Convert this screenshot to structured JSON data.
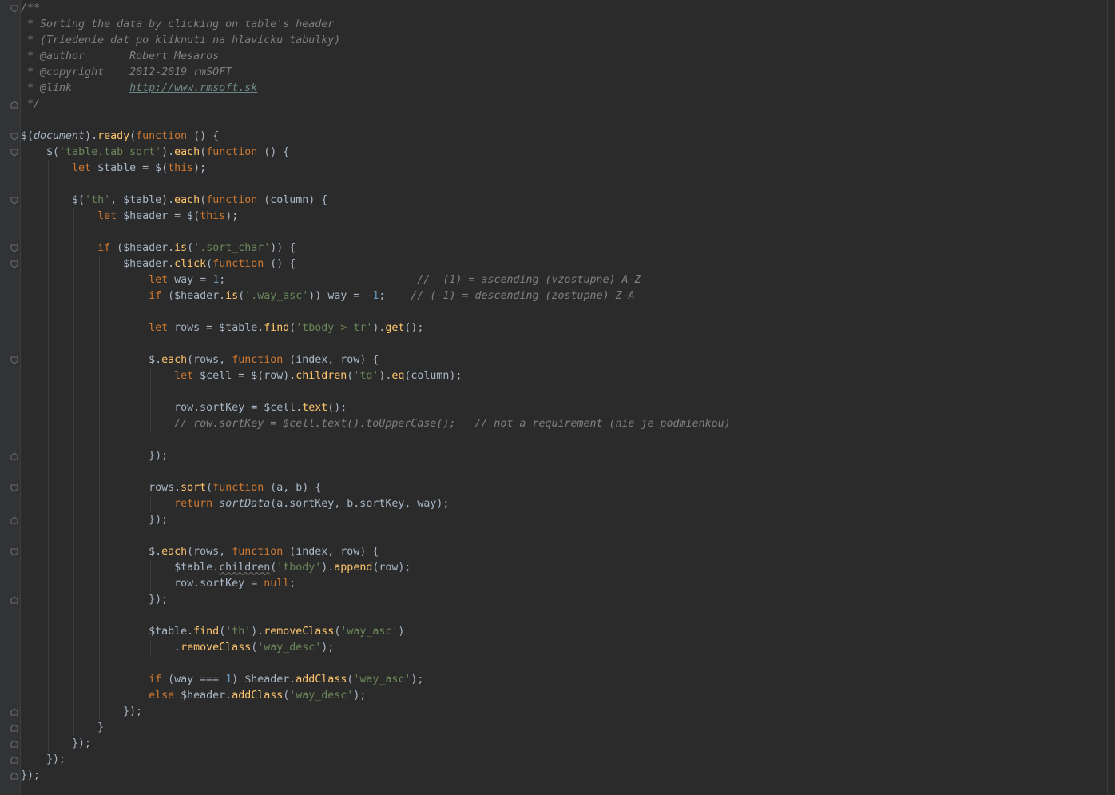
{
  "editor": {
    "language": "javascript",
    "colors": {
      "background": "#2b2b2b",
      "gutter": "#313335",
      "keyword": "#cc7832",
      "string": "#6a8759",
      "number": "#6897bb",
      "function": "#ffc66d",
      "comment": "#808080",
      "text": "#a9b7c6"
    },
    "lines": [
      [
        [
          "cmt",
          "/**"
        ]
      ],
      [
        [
          "cmt",
          " * Sorting the data by clicking on table's header"
        ]
      ],
      [
        [
          "cmt",
          " * (Triedenie dat po kliknuti na hlavicku tabulky)"
        ]
      ],
      [
        [
          "cmt",
          " * "
        ],
        [
          "tag",
          "@author"
        ],
        [
          "cmt",
          "       Robert Mesaros"
        ]
      ],
      [
        [
          "cmt",
          " * "
        ],
        [
          "tag",
          "@copyright"
        ],
        [
          "cmt",
          "    2012-2019 rmSOFT"
        ]
      ],
      [
        [
          "cmt",
          " * "
        ],
        [
          "tag",
          "@link"
        ],
        [
          "cmt",
          "         "
        ],
        [
          "url",
          "http://www.rmsoft.sk"
        ]
      ],
      [
        [
          "cmt",
          " */"
        ]
      ],
      [],
      [
        [
          "plain",
          "$("
        ],
        [
          "glob",
          "document"
        ],
        [
          "plain",
          ")."
        ],
        [
          "fn",
          "ready"
        ],
        [
          "plain",
          "("
        ],
        [
          "kw",
          "function"
        ],
        [
          "plain",
          " () {"
        ]
      ],
      [
        [
          "plain",
          "    $("
        ],
        [
          "str",
          "'table.tab_sort'"
        ],
        [
          "plain",
          ")."
        ],
        [
          "fn",
          "each"
        ],
        [
          "plain",
          "("
        ],
        [
          "kw",
          "function"
        ],
        [
          "plain",
          " () {"
        ]
      ],
      [
        [
          "plain",
          "        "
        ],
        [
          "kw",
          "let "
        ],
        [
          "plain",
          "$table = $("
        ],
        [
          "kw",
          "this"
        ],
        [
          "plain",
          ");"
        ]
      ],
      [],
      [
        [
          "plain",
          "        $("
        ],
        [
          "str",
          "'th'"
        ],
        [
          "plain",
          ", $table)."
        ],
        [
          "fn",
          "each"
        ],
        [
          "plain",
          "("
        ],
        [
          "kw",
          "function"
        ],
        [
          "plain",
          " (column) {"
        ]
      ],
      [
        [
          "plain",
          "            "
        ],
        [
          "kw",
          "let "
        ],
        [
          "plain",
          "$header = $("
        ],
        [
          "kw",
          "this"
        ],
        [
          "plain",
          ");"
        ]
      ],
      [],
      [
        [
          "plain",
          "            "
        ],
        [
          "kw",
          "if "
        ],
        [
          "plain",
          "($header."
        ],
        [
          "fn",
          "is"
        ],
        [
          "plain",
          "("
        ],
        [
          "str",
          "'.sort_char'"
        ],
        [
          "plain",
          ")) {"
        ]
      ],
      [
        [
          "plain",
          "                $header."
        ],
        [
          "fn",
          "click"
        ],
        [
          "plain",
          "("
        ],
        [
          "kw",
          "function"
        ],
        [
          "plain",
          " () {"
        ]
      ],
      [
        [
          "plain",
          "                    "
        ],
        [
          "kw",
          "let "
        ],
        [
          "plain",
          "way = "
        ],
        [
          "num",
          "1"
        ],
        [
          "plain",
          ";                              "
        ],
        [
          "cmt",
          "//  (1) = ascending (vzostupne) A-Z"
        ]
      ],
      [
        [
          "plain",
          "                    "
        ],
        [
          "kw",
          "if "
        ],
        [
          "plain",
          "($header."
        ],
        [
          "fn",
          "is"
        ],
        [
          "plain",
          "("
        ],
        [
          "str",
          "'.way_asc'"
        ],
        [
          "plain",
          ")) way = -"
        ],
        [
          "num",
          "1"
        ],
        [
          "plain",
          ";    "
        ],
        [
          "cmt",
          "// (-1) = descending (zostupne) Z-A"
        ]
      ],
      [],
      [
        [
          "plain",
          "                    "
        ],
        [
          "kw",
          "let "
        ],
        [
          "plain",
          "rows = $table."
        ],
        [
          "fn",
          "find"
        ],
        [
          "plain",
          "("
        ],
        [
          "str",
          "'tbody > tr'"
        ],
        [
          "plain",
          ")."
        ],
        [
          "fn",
          "get"
        ],
        [
          "plain",
          "();"
        ]
      ],
      [],
      [
        [
          "plain",
          "                    $."
        ],
        [
          "fn",
          "each"
        ],
        [
          "plain",
          "(rows, "
        ],
        [
          "kw",
          "function"
        ],
        [
          "plain",
          " (index, row) {"
        ]
      ],
      [
        [
          "plain",
          "                        "
        ],
        [
          "kw",
          "let "
        ],
        [
          "plain",
          "$cell = $(row)."
        ],
        [
          "fn",
          "children"
        ],
        [
          "plain",
          "("
        ],
        [
          "str",
          "'td'"
        ],
        [
          "plain",
          ")."
        ],
        [
          "fn",
          "eq"
        ],
        [
          "plain",
          "(column);"
        ]
      ],
      [],
      [
        [
          "plain",
          "                        row."
        ],
        [
          "plain",
          "sortKey"
        ],
        [
          "plain",
          " = $cell."
        ],
        [
          "fn",
          "text"
        ],
        [
          "plain",
          "();"
        ]
      ],
      [
        [
          "plain",
          "                        "
        ],
        [
          "cmt",
          "// row.sortKey = $cell.text().toUpperCase();   // not a requirement (nie je podmienkou)"
        ]
      ],
      [],
      [
        [
          "plain",
          "                    });"
        ]
      ],
      [],
      [
        [
          "plain",
          "                    rows."
        ],
        [
          "fn",
          "sort"
        ],
        [
          "plain",
          "("
        ],
        [
          "kw",
          "function"
        ],
        [
          "plain",
          " (a, b) {"
        ]
      ],
      [
        [
          "plain",
          "                        "
        ],
        [
          "kw",
          "return "
        ],
        [
          "glob",
          "sortData"
        ],
        [
          "plain",
          "(a.sortKey, b.sortKey, way);"
        ]
      ],
      [
        [
          "plain",
          "                    });"
        ]
      ],
      [],
      [
        [
          "plain",
          "                    $."
        ],
        [
          "fn",
          "each"
        ],
        [
          "plain",
          "(rows, "
        ],
        [
          "kw",
          "function"
        ],
        [
          "plain",
          " (index, row) {"
        ]
      ],
      [
        [
          "plain",
          "                        $table."
        ],
        [
          "wavy",
          "children"
        ],
        [
          "plain",
          "("
        ],
        [
          "str",
          "'tbody'"
        ],
        [
          "plain",
          ")."
        ],
        [
          "fn",
          "append"
        ],
        [
          "plain",
          "(row);"
        ]
      ],
      [
        [
          "plain",
          "                        row.sortKey = "
        ],
        [
          "kw",
          "null"
        ],
        [
          "plain",
          ";"
        ]
      ],
      [
        [
          "plain",
          "                    });"
        ]
      ],
      [],
      [
        [
          "plain",
          "                    $table."
        ],
        [
          "fn",
          "find"
        ],
        [
          "plain",
          "("
        ],
        [
          "str",
          "'th'"
        ],
        [
          "plain",
          ")."
        ],
        [
          "fn",
          "removeClass"
        ],
        [
          "plain",
          "("
        ],
        [
          "str",
          "'way_asc'"
        ],
        [
          "plain",
          ")"
        ]
      ],
      [
        [
          "plain",
          "                        ."
        ],
        [
          "fn",
          "removeClass"
        ],
        [
          "plain",
          "("
        ],
        [
          "str",
          "'way_desc'"
        ],
        [
          "plain",
          ");"
        ]
      ],
      [],
      [
        [
          "plain",
          "                    "
        ],
        [
          "kw",
          "if "
        ],
        [
          "plain",
          "(way === "
        ],
        [
          "num",
          "1"
        ],
        [
          "plain",
          ") $header."
        ],
        [
          "fn",
          "addClass"
        ],
        [
          "plain",
          "("
        ],
        [
          "str",
          "'way_asc'"
        ],
        [
          "plain",
          ");"
        ]
      ],
      [
        [
          "plain",
          "                    "
        ],
        [
          "kw",
          "else "
        ],
        [
          "plain",
          "$header."
        ],
        [
          "fn",
          "addClass"
        ],
        [
          "plain",
          "("
        ],
        [
          "str",
          "'way_desc'"
        ],
        [
          "plain",
          ");"
        ]
      ],
      [
        [
          "plain",
          "                });"
        ]
      ],
      [
        [
          "plain",
          "            }"
        ]
      ],
      [
        [
          "plain",
          "        });"
        ]
      ],
      [
        [
          "plain",
          "    });"
        ]
      ],
      [
        [
          "plain",
          "});"
        ]
      ]
    ],
    "fold_markers": [
      {
        "line": 1,
        "kind": "open"
      },
      {
        "line": 7,
        "kind": "close"
      },
      {
        "line": 9,
        "kind": "open"
      },
      {
        "line": 10,
        "kind": "open"
      },
      {
        "line": 13,
        "kind": "open"
      },
      {
        "line": 16,
        "kind": "open"
      },
      {
        "line": 17,
        "kind": "open"
      },
      {
        "line": 23,
        "kind": "open"
      },
      {
        "line": 29,
        "kind": "close"
      },
      {
        "line": 31,
        "kind": "open"
      },
      {
        "line": 33,
        "kind": "close"
      },
      {
        "line": 35,
        "kind": "open"
      },
      {
        "line": 38,
        "kind": "close"
      },
      {
        "line": 45,
        "kind": "close"
      },
      {
        "line": 46,
        "kind": "close"
      },
      {
        "line": 47,
        "kind": "close"
      },
      {
        "line": 48,
        "kind": "close"
      },
      {
        "line": 49,
        "kind": "close"
      }
    ]
  }
}
